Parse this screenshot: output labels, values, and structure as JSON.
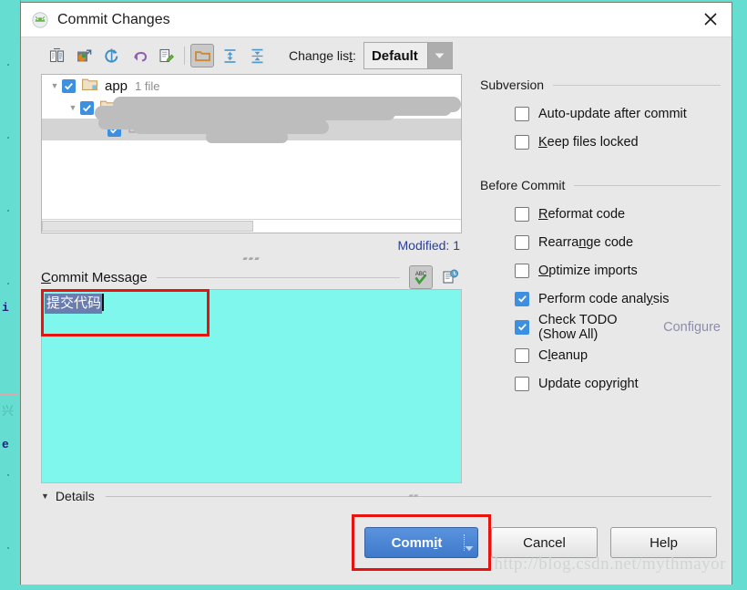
{
  "window": {
    "title": "Commit Changes",
    "app_icon": "android-studio-icon",
    "close_icon": "close-icon"
  },
  "toolbar": {
    "buttons": [
      {
        "name": "show-diff-icon",
        "tooltip": "Show Diff"
      },
      {
        "name": "revert-selected-icon",
        "tooltip": "Move to Another Changelist"
      },
      {
        "name": "refresh-icon",
        "tooltip": "Refresh"
      },
      {
        "name": "rollback-icon",
        "tooltip": "Rollback"
      },
      {
        "name": "edit-source-icon",
        "tooltip": "Edit Source"
      },
      {
        "name": "group-by-directory-icon",
        "tooltip": "Group by Directory",
        "pressed": true
      },
      {
        "name": "expand-all-icon",
        "tooltip": "Expand All"
      },
      {
        "name": "collapse-all-icon",
        "tooltip": "Collapse All"
      }
    ],
    "change_list_label_pre": "Change lis",
    "change_list_label_mnemonic": "t",
    "change_list_label_post": ":",
    "change_list_value": "Default",
    "change_list_arrow": "chevron-down-icon"
  },
  "file_tree": {
    "rows": [
      {
        "indent": 0,
        "expanded": true,
        "checked": true,
        "icon": "folder-icon",
        "label": "app",
        "sub": "1 file",
        "redacted": false,
        "selected": false
      },
      {
        "indent": 1,
        "expanded": true,
        "checked": true,
        "icon": "folder-icon",
        "label": "",
        "sub": "",
        "redacted": true,
        "selected": false
      },
      {
        "indent": 2,
        "expanded": false,
        "checked": true,
        "icon": "file-icon",
        "label": "",
        "sub": "",
        "redacted": true,
        "selected": true
      }
    ],
    "scrollbar": "horizontal-scrollbar",
    "modified_label": "Modified: 1"
  },
  "commit_message": {
    "label_mnemonic": "C",
    "label_rest": "ommit Message",
    "value": "提交代码",
    "selected": true,
    "icons": [
      {
        "name": "spellcheck-icon",
        "label": "ABC",
        "pressed": true
      },
      {
        "name": "commit-message-history-icon",
        "pressed": false
      }
    ],
    "background_color": "#7ff7ec",
    "selection_color": "#6b7daf",
    "highlight_box_color": "#e8120f"
  },
  "right_panel": {
    "groups": [
      {
        "title": "Subversion",
        "items": [
          {
            "label_pre": "",
            "label_mn": "",
            "label_post": "Auto-update after commit",
            "checked": false,
            "name": "auto-update-after-commit"
          },
          {
            "label_pre": "",
            "label_mn": "K",
            "label_post": "eep files locked",
            "checked": false,
            "name": "keep-files-locked"
          }
        ]
      },
      {
        "title": "Before Commit",
        "items": [
          {
            "label_pre": "",
            "label_mn": "R",
            "label_post": "eformat code",
            "checked": false,
            "name": "reformat-code"
          },
          {
            "label_pre": "Rearra",
            "label_mn": "n",
            "label_post": "ge code",
            "checked": false,
            "name": "rearrange-code"
          },
          {
            "label_pre": "",
            "label_mn": "O",
            "label_post": "ptimize imports",
            "checked": false,
            "name": "optimize-imports"
          },
          {
            "label_pre": "Perform code anal",
            "label_mn": "y",
            "label_post": "sis",
            "checked": true,
            "name": "perform-code-analysis"
          },
          {
            "label_pre": "Check TODO (Show All)",
            "label_mn": "",
            "label_post": "",
            "checked": true,
            "name": "check-todo",
            "link": "Configure"
          },
          {
            "label_pre": "C",
            "label_mn": "l",
            "label_post": "eanup",
            "checked": false,
            "name": "cleanup"
          },
          {
            "label_pre": "Update copyright",
            "label_mn": "",
            "label_post": "",
            "checked": false,
            "name": "update-copyright"
          }
        ]
      }
    ]
  },
  "details": {
    "label": "Details",
    "expanded": true,
    "triangle_icon": "chevron-down-icon"
  },
  "footer": {
    "commit_pre": "Comm",
    "commit_mn": "i",
    "commit_post": "t",
    "commit_dropdown_icon": "chevron-down-icon",
    "cancel_label": "Cancel",
    "help_label": "Help",
    "commit_highlight_color": "#e8120f",
    "primary_color": "#3f79ca"
  },
  "watermark": "http://blog.csdn.net/mythmayor"
}
